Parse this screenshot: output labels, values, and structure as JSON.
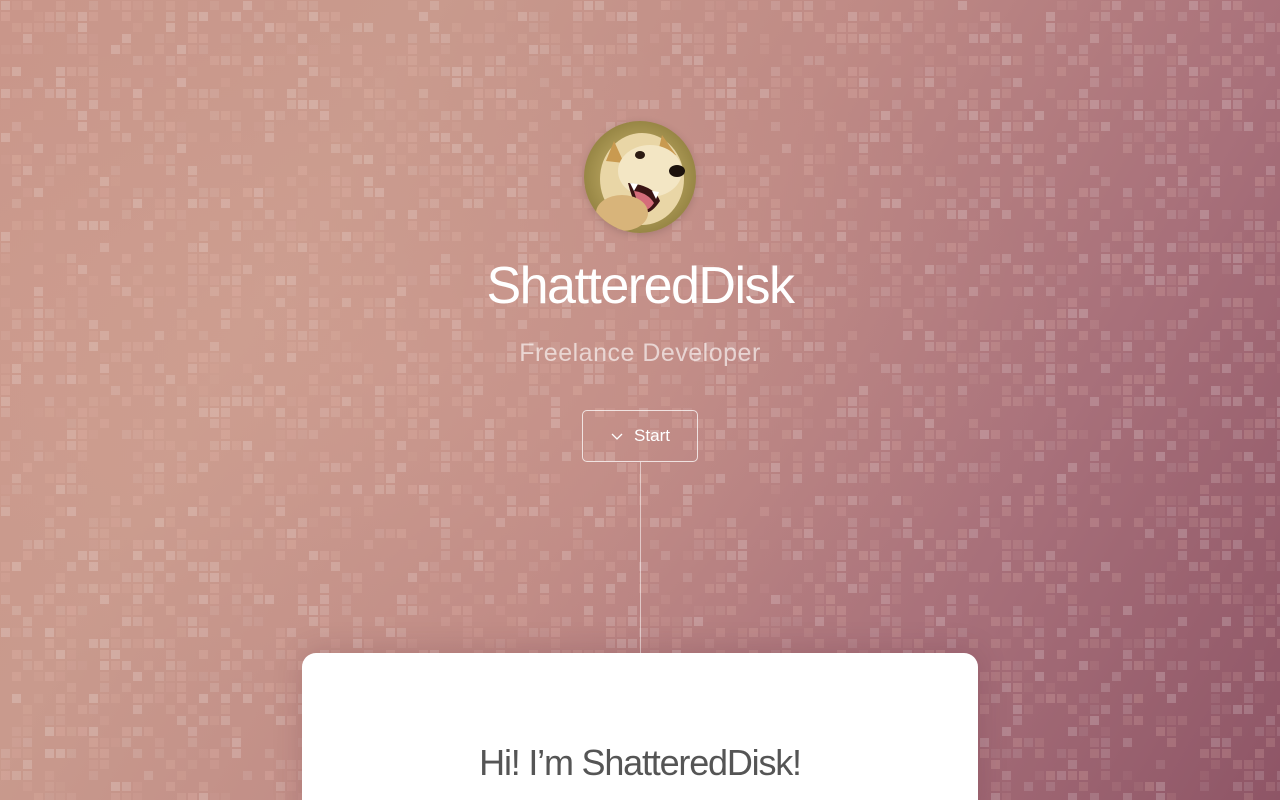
{
  "profile": {
    "name": "ShatteredDisk",
    "role": "Freelance Developer",
    "avatar_icon": "shiba-avatar-icon"
  },
  "start_button": {
    "label": "Start",
    "icon": "chevron-down-icon"
  },
  "intro_card": {
    "heading": "Hi! I’m ShatteredDisk!"
  },
  "colors": {
    "background_start": "#c9968a",
    "background_end": "#8e5566",
    "text_light": "#ffffff",
    "card_background": "#ffffff",
    "card_heading": "#555555"
  }
}
